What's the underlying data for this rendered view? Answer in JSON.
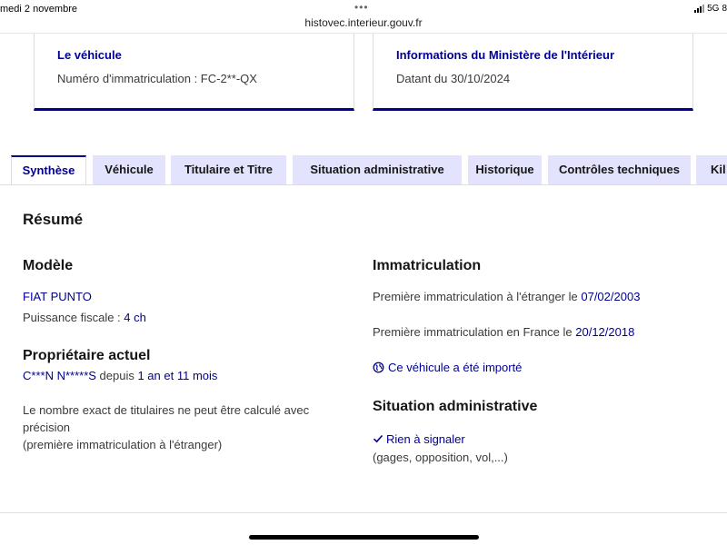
{
  "statusbar": {
    "time": "medi 2 novembre",
    "dots": "•••",
    "url": "histovec.interieur.gouv.fr",
    "network": "5G",
    "battery": "8"
  },
  "cards": [
    {
      "title": "Le véhicule",
      "text": "Numéro d'immatriculation : FC-2**-QX"
    },
    {
      "title": "Informations du Ministère de l'Intérieur",
      "text": "Datant du 30/10/2024"
    }
  ],
  "tabs": [
    {
      "label": "Synthèse",
      "active": true
    },
    {
      "label": "Véhicule"
    },
    {
      "label": "Titulaire et Titre"
    },
    {
      "label": "Situation administrative"
    },
    {
      "label": "Historique"
    },
    {
      "label": "Contrôles techniques"
    },
    {
      "label": "Kil"
    }
  ],
  "summary": {
    "title": "Résumé",
    "model": {
      "heading": "Modèle",
      "name": "FIAT PUNTO",
      "power_label": "Puissance fiscale : ",
      "power_value": "4 ch"
    },
    "owner": {
      "heading": "Propriétaire actuel",
      "name": "C***N N*****S",
      "since_label": " depuis ",
      "since_value": "1 an et 11 mois",
      "note_line1": "Le nombre exact de titulaires ne peut être calculé avec",
      "note_line2": "précision",
      "note_line3": "(première immatriculation à l'étranger)"
    },
    "registration": {
      "heading": "Immatriculation",
      "foreign_label": "Première immatriculation à l'étranger le ",
      "foreign_date": "07/02/2003",
      "france_label": "Première immatriculation en France le ",
      "france_date": "20/12/2018",
      "imported_link": "Ce véhicule a été importé",
      "icon": "globe-icon"
    },
    "admin": {
      "heading": "Situation administrative",
      "status": "Rien à signaler",
      "details": "(gages, opposition, vol,...)",
      "icon": "check-icon"
    }
  },
  "colors": {
    "accent": "#000091",
    "tab_bg": "#e3e3fd",
    "text": "#3a3a3a"
  }
}
